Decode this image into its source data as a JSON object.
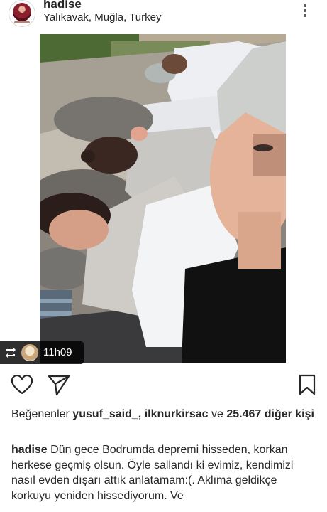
{
  "post": {
    "username": "hadise",
    "location": "Yalıkavak, Muğla, Turkey"
  },
  "repost": {
    "time": "11h09"
  },
  "icons": {
    "more": "more-vertical-icon",
    "like": "heart-icon",
    "share": "send-icon",
    "save": "bookmark-icon",
    "repost": "repost-icon"
  },
  "likes": {
    "prefix": "Beğenenler",
    "user1": "yusuf_said_",
    "separator": ",",
    "user2": "ilknurkirsac",
    "conjunction": "ve",
    "count": "25.467 diğer kişi"
  },
  "caption": {
    "username": "hadise",
    "text": "Dün gece Bodrumda depremi hisseden, korkan herkese geçmiş olsun. Öyle sallandı ki evimiz, kendimizi nasıl evden dışarı attık anlatamam:(. Aklıma geldikçe korkuyu yeniden hissediyorum. Ve"
  },
  "colors": {
    "text": "#262626",
    "badge_bg": "#000000",
    "badge_text": "#ffffff"
  }
}
